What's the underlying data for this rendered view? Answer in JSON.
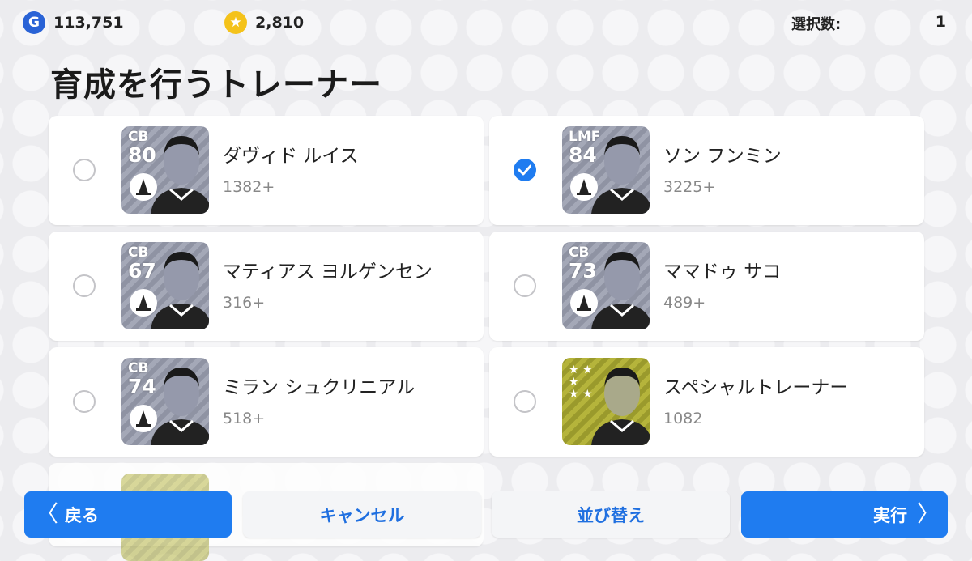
{
  "currency": {
    "gp_icon_glyph": "G",
    "gp_value": "113,751",
    "coin_value": "2,810"
  },
  "selection": {
    "label": "選択数:",
    "count": "1"
  },
  "title": "育成を行うトレーナー",
  "trainers": [
    {
      "position": "CB",
      "rating": "80",
      "name": "ダヴィド ルイス",
      "cost": "1382+",
      "selected": false
    },
    {
      "position": "LMF",
      "rating": "84",
      "name": "ソン フンミン",
      "cost": "3225+",
      "selected": true
    },
    {
      "position": "CB",
      "rating": "67",
      "name": "マティアス ヨルゲンセン",
      "cost": "316+",
      "selected": false
    },
    {
      "position": "CB",
      "rating": "73",
      "name": "ママドゥ サコ",
      "cost": "489+",
      "selected": false
    },
    {
      "position": "CB",
      "rating": "74",
      "name": "ミラン シュクリニアル",
      "cost": "518+",
      "selected": false
    },
    {
      "position": "",
      "rating": "",
      "name": "スペシャルトレーナー",
      "cost": "1082",
      "selected": false,
      "special": true
    }
  ],
  "footer": {
    "back_label": "戻る",
    "cancel_label": "キャンセル",
    "sort_label": "並び替え",
    "execute_label": "実行",
    "chevron_left": "〈",
    "chevron_right": "〉"
  },
  "colors": {
    "accent": "#1f7cf0",
    "gp": "#2a63d6",
    "coin": "#f4c21a"
  }
}
